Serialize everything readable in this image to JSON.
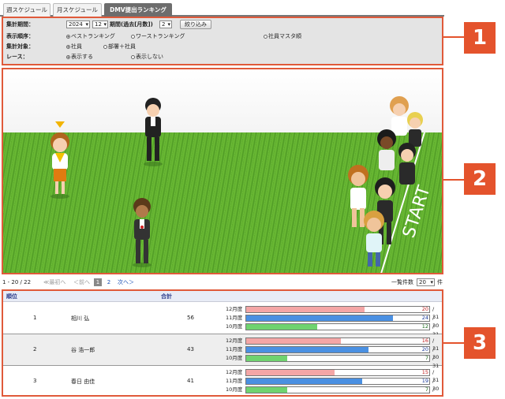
{
  "tabs": [
    {
      "label": "週スケジュール",
      "active": false
    },
    {
      "label": "月スケジュール",
      "active": false
    },
    {
      "label": "DMV提出ランキング",
      "active": true
    }
  ],
  "filter": {
    "period_label": "集計期間：",
    "year_value": "2024",
    "month_value": "12",
    "span_label": "期間(過去[月数])",
    "span_value": "2",
    "apply_button": "絞り込み",
    "order_label": "表示順序：",
    "order_options": [
      "ベストランキング",
      "ワーストランキング",
      "社員マスタ順"
    ],
    "order_selected": 0,
    "target_label": "集計対象：",
    "target_options": [
      "社員",
      "部署＋社員"
    ],
    "target_selected": 0,
    "race_label": "レース：",
    "race_options": [
      "表示する",
      "表示しない"
    ],
    "race_selected": 0
  },
  "scene": {
    "start_text": "START"
  },
  "callouts": [
    "1",
    "2",
    "3"
  ],
  "pager": {
    "range": "1 - 20 / 22",
    "first": "≪最初へ",
    "prev": "＜前へ",
    "pages": [
      "1",
      "2"
    ],
    "current_page": "1",
    "next": "次へ＞",
    "per_page_label": "一覧件数",
    "per_page_value": "20",
    "per_page_suffix": "件"
  },
  "table": {
    "col_rank": "順位",
    "col_total": "合計",
    "rows": [
      {
        "rank": "1",
        "name": "相川 弘",
        "total": "56",
        "months": [
          {
            "label": "12月度",
            "value": 20,
            "max": 31,
            "color": "#f4a6a6"
          },
          {
            "label": "11月度",
            "value": 24,
            "max": 30,
            "color": "#4a90e2"
          },
          {
            "label": "10月度",
            "value": 12,
            "max": 31,
            "color": "#6fd36f"
          }
        ]
      },
      {
        "rank": "2",
        "name": "谷 浩一郎",
        "total": "43",
        "months": [
          {
            "label": "12月度",
            "value": 16,
            "max": 31,
            "color": "#f4a6a6"
          },
          {
            "label": "11月度",
            "value": 20,
            "max": 30,
            "color": "#4a90e2"
          },
          {
            "label": "10月度",
            "value": 7,
            "max": 31,
            "color": "#6fd36f"
          }
        ]
      },
      {
        "rank": "3",
        "name": "春日 由佳",
        "total": "41",
        "months": [
          {
            "label": "12月度",
            "value": 15,
            "max": 31,
            "color": "#f4a6a6"
          },
          {
            "label": "11月度",
            "value": 19,
            "max": 30,
            "color": "#4a90e2"
          },
          {
            "label": "10月度",
            "value": 7,
            "max": 31,
            "color": "#6fd36f"
          }
        ]
      }
    ]
  },
  "colors": {
    "accent": "#e4532c",
    "tab_active": "#6d6d6d"
  }
}
